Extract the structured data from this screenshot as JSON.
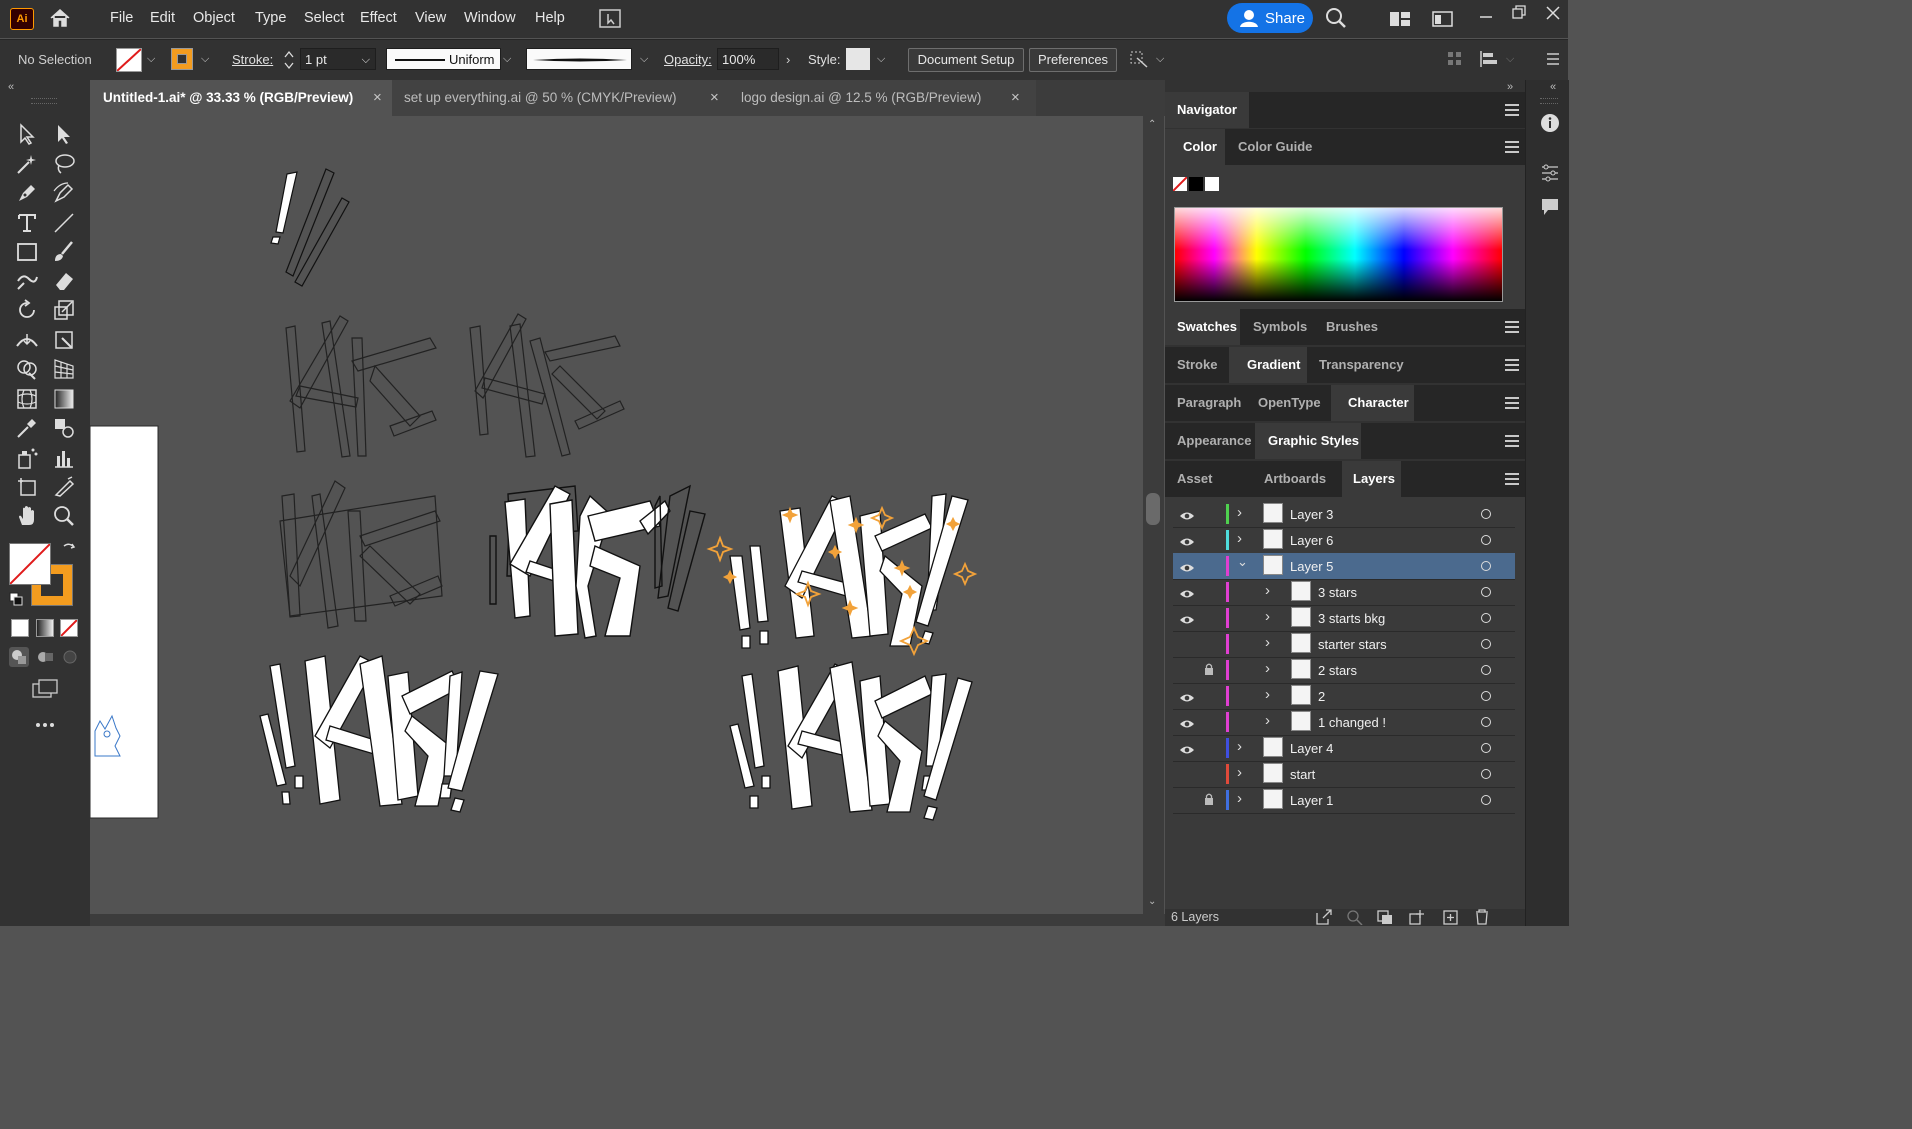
{
  "app": {
    "logo": "Ai"
  },
  "menubar": {
    "items": [
      "File",
      "Edit",
      "Object",
      "Type",
      "Select",
      "Effect",
      "View",
      "Window",
      "Help"
    ],
    "share_label": "Share"
  },
  "control": {
    "selection": "No Selection",
    "stroke_label": "Stroke:",
    "stroke_weight": "1 pt",
    "profile": "Uniform",
    "opacity_label": "Opacity:",
    "opacity_value": "100%",
    "style_label": "Style:",
    "document_setup": "Document Setup",
    "preferences": "Preferences"
  },
  "tabs": [
    {
      "label": "Untitled-1.ai* @ 33.33 % (RGB/Preview)",
      "active": true
    },
    {
      "label": "set up everything.ai @ 50 % (CMYK/Preview)",
      "active": false
    },
    {
      "label": "logo design.ai @ 12.5 % (RGB/Preview)",
      "active": false
    }
  ],
  "panels": {
    "navigator": "Navigator",
    "color_group": [
      "Color",
      "Color Guide"
    ],
    "swatch_group": [
      "Swatches",
      "Symbols",
      "Brushes"
    ],
    "stroke_group": [
      "Stroke",
      "Gradient",
      "Transparency"
    ],
    "para_group": [
      "Paragraph",
      "OpenType",
      "Character"
    ],
    "appear_group": [
      "Appearance",
      "Graphic Styles"
    ],
    "layers_group": [
      "Asset Export",
      "Artboards",
      "Layers"
    ]
  },
  "layers": [
    {
      "name": "Layer 3",
      "visible": true,
      "locked": false,
      "color": "#4fd14f",
      "expanded": false,
      "sub": false,
      "selected": false
    },
    {
      "name": "Layer 6",
      "visible": true,
      "locked": false,
      "color": "#4fdcdc",
      "expanded": false,
      "sub": false,
      "selected": false
    },
    {
      "name": "Layer 5",
      "visible": true,
      "locked": false,
      "color": "#e03fd2",
      "expanded": true,
      "sub": false,
      "selected": true
    },
    {
      "name": "3 stars",
      "visible": true,
      "locked": false,
      "color": "#e03fd2",
      "expanded": false,
      "sub": true,
      "selected": false
    },
    {
      "name": "3 starts bkg",
      "visible": true,
      "locked": false,
      "color": "#e03fd2",
      "expanded": false,
      "sub": true,
      "selected": false
    },
    {
      "name": "starter stars",
      "visible": false,
      "locked": false,
      "color": "#e03fd2",
      "expanded": false,
      "sub": true,
      "selected": false
    },
    {
      "name": "2 stars",
      "visible": false,
      "locked": true,
      "color": "#e03fd2",
      "expanded": false,
      "sub": true,
      "selected": false
    },
    {
      "name": "2",
      "visible": true,
      "locked": false,
      "color": "#e03fd2",
      "expanded": false,
      "sub": true,
      "selected": false
    },
    {
      "name": "1 changed !",
      "visible": true,
      "locked": false,
      "color": "#e03fd2",
      "expanded": false,
      "sub": true,
      "selected": false
    },
    {
      "name": "Layer 4",
      "visible": true,
      "locked": false,
      "color": "#3f4fe0",
      "expanded": false,
      "sub": false,
      "selected": false
    },
    {
      "name": "start",
      "visible": false,
      "locked": false,
      "color": "#e04a3a",
      "expanded": false,
      "sub": false,
      "selected": false
    },
    {
      "name": "Layer 1",
      "visible": false,
      "locked": true,
      "color": "#3f6fe0",
      "expanded": false,
      "sub": false,
      "selected": false
    }
  ],
  "layers_footer": "6 Layers",
  "colors": {
    "accent": "#1473e6",
    "fill_orange": "#f39c1f",
    "star_orange": "#f2a23a"
  }
}
